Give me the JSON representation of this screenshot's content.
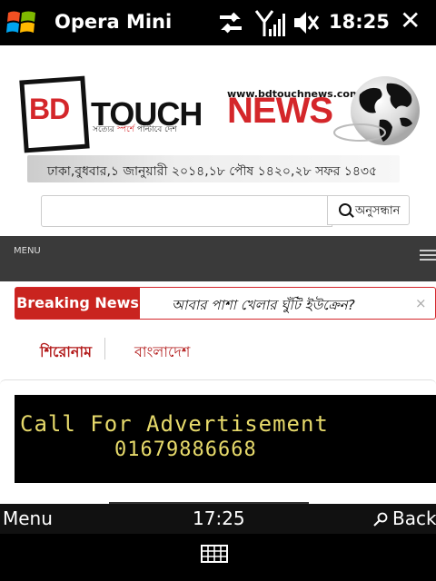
{
  "statusbar": {
    "app_title": "Opera Mini",
    "time": "18:25"
  },
  "page": {
    "logo": {
      "bd": "BD",
      "touch": "TOUCH",
      "news": "NEWS",
      "url": "www.bdtouchnews.com",
      "tagline_pre": "সত্যের ",
      "tagline_red": "স্পর্শে",
      "tagline_post": " পাল্টাবে দেশ"
    },
    "date_line": "ঢাকা,বুধবার,১ জানুয়ারী ২০১৪,১৮ পৌষ ১৪২০,২৮ সফর ১৪৩৫",
    "search": {
      "value": "",
      "button_label": "অনুসন্ধান"
    },
    "menu_label": "MENU",
    "breaking": {
      "label": "Breaking News",
      "headline": "আবার পাশা খেলার ঘুঁটি ইউক্রেন?",
      "close": "×"
    },
    "tabs": [
      "শিরোনাম",
      "বাংলাদেশ"
    ],
    "ad": {
      "line1": "Call For Advertisement",
      "line2": "01679886668"
    }
  },
  "softkeys": {
    "left": "Menu",
    "time": "17:25",
    "right": "Back"
  },
  "colors": {
    "brand_red": "#d4262a",
    "ad_text": "#e7da6b"
  }
}
